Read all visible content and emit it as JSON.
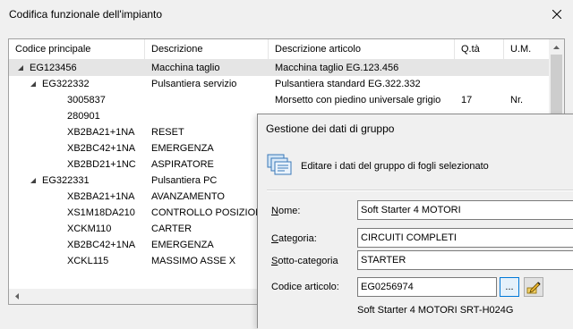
{
  "window": {
    "title": "Codifica funzionale dell'impianto"
  },
  "tree": {
    "columns": [
      "Codice principale",
      "Descrizione",
      "Descrizione articolo",
      "Q.tà",
      "U.M."
    ],
    "rows": [
      {
        "level": 0,
        "expander": "expanded",
        "code": "EG123456",
        "desc": "Macchina taglio",
        "article": "Macchina taglio EG.123.456",
        "qty": "",
        "um": "",
        "selected": true
      },
      {
        "level": 1,
        "expander": "expanded",
        "code": "EG322332",
        "desc": "Pulsantiera servizio",
        "article": "Pulsantiera standard EG.322.332",
        "qty": "",
        "um": "",
        "selected": false
      },
      {
        "level": 2,
        "expander": "none",
        "code": "3005837",
        "desc": "",
        "article": "Morsetto con piedino universale grigio",
        "qty": "17",
        "um": "Nr.",
        "selected": false
      },
      {
        "level": 2,
        "expander": "none",
        "code": "280901",
        "desc": "",
        "article": "",
        "qty": "",
        "um": "",
        "selected": false
      },
      {
        "level": 2,
        "expander": "none",
        "code": "XB2BA21+1NA",
        "desc": "RESET",
        "article": "",
        "qty": "",
        "um": "",
        "selected": false
      },
      {
        "level": 2,
        "expander": "none",
        "code": "XB2BC42+1NA",
        "desc": "EMERGENZA",
        "article": "",
        "qty": "",
        "um": "",
        "selected": false
      },
      {
        "level": 2,
        "expander": "none",
        "code": "XB2BD21+1NC",
        "desc": "ASPIRATORE",
        "article": "",
        "qty": "",
        "um": "",
        "selected": false
      },
      {
        "level": 1,
        "expander": "expanded",
        "code": "EG322331",
        "desc": "Pulsantiera PC",
        "article": "",
        "qty": "",
        "um": "",
        "selected": false
      },
      {
        "level": 2,
        "expander": "none",
        "code": "XB2BA21+1NA",
        "desc": "AVANZAMENTO",
        "article": "",
        "qty": "",
        "um": "",
        "selected": false
      },
      {
        "level": 2,
        "expander": "none",
        "code": "XS1M18DA210",
        "desc": "CONTROLLO POSIZIONE",
        "article": "",
        "qty": "",
        "um": "",
        "selected": false
      },
      {
        "level": 2,
        "expander": "none",
        "code": "XCKM110",
        "desc": "CARTER",
        "article": "",
        "qty": "",
        "um": "",
        "selected": false
      },
      {
        "level": 2,
        "expander": "none",
        "code": "XB2BC42+1NA",
        "desc": "EMERGENZA",
        "article": "",
        "qty": "",
        "um": "",
        "selected": false
      },
      {
        "level": 2,
        "expander": "none",
        "code": "XCKL115",
        "desc": "MASSIMO ASSE X",
        "article": "",
        "qty": "",
        "um": "",
        "selected": false
      }
    ]
  },
  "dialog": {
    "title": "Gestione dei dati di gruppo",
    "description": "Editare i dati del gruppo di fogli selezionato",
    "fields": {
      "nome": {
        "label_u": "N",
        "label_rest": "ome:",
        "value": "Soft Starter 4 MOTORI"
      },
      "categoria": {
        "label_u": "C",
        "label_rest": "ategoria:",
        "value": "CIRCUITI COMPLETI"
      },
      "sottocategoria": {
        "label_u": "S",
        "label_rest": "otto-categoria",
        "value": "STARTER"
      },
      "codice": {
        "label_u": "",
        "label_rest": "Codice articolo:",
        "value": "EG0256974",
        "button": "..."
      }
    },
    "article_description": "Soft Starter 4 MOTORI SRT-H024G"
  },
  "icons": {
    "close": "close-icon",
    "expander": "tree-expander-icon",
    "group": "sheet-group-icon",
    "edit": "edit-pencil-icon"
  }
}
